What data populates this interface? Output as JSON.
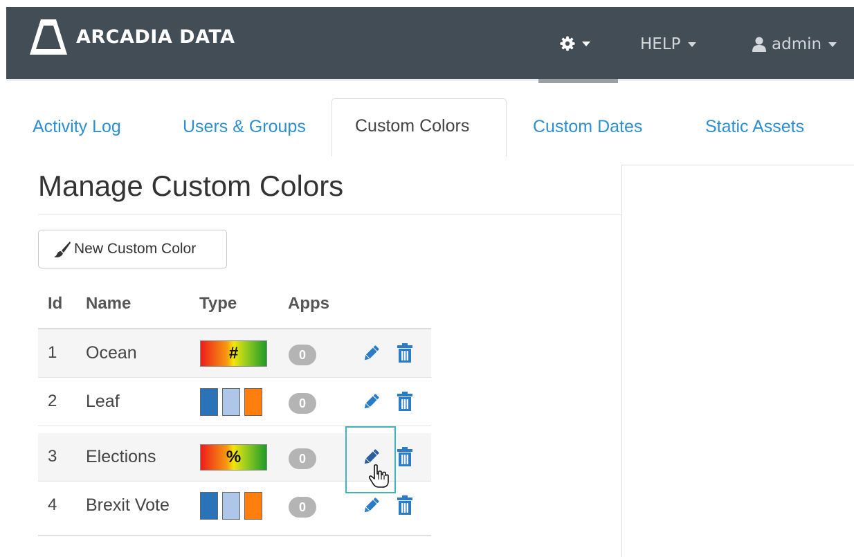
{
  "header": {
    "brand": "ARCADIA DATA",
    "help_label": "HELP",
    "user_label": "admin"
  },
  "tabs": [
    {
      "label": "Activity Log",
      "active": false
    },
    {
      "label": "Users & Groups",
      "active": false
    },
    {
      "label": "Custom Colors",
      "active": true
    },
    {
      "label": "Custom Dates",
      "active": false
    },
    {
      "label": "Static Assets",
      "active": false
    }
  ],
  "page": {
    "title": "Manage Custom Colors",
    "new_button_label": "New Custom Color"
  },
  "table": {
    "columns": [
      "Id",
      "Name",
      "Type",
      "Apps"
    ],
    "rows": [
      {
        "id": "1",
        "name": "Ocean",
        "type": "gradient",
        "gradient_symbol": "#",
        "apps": "0"
      },
      {
        "id": "2",
        "name": "Leaf",
        "type": "distinct",
        "apps": "0"
      },
      {
        "id": "3",
        "name": "Elections",
        "type": "gradient",
        "gradient_symbol": "%",
        "apps": "0"
      },
      {
        "id": "4",
        "name": "Brexit Vote",
        "type": "distinct",
        "apps": "0"
      }
    ]
  },
  "colors": {
    "header_bg": "#434d56",
    "link": "#2d8fd3",
    "icon_blue": "#2b7cc7",
    "icon_blue_active": "#2a5f9e",
    "badge": "#b4b4b4",
    "focus_outline": "#41b3bd",
    "gradient": [
      "#ee1c1c",
      "#f79a10",
      "#f2e60a",
      "#8cc820",
      "#1f9a2a"
    ],
    "distinct_palette": [
      "#2a73b8",
      "#aec7e8",
      "#ff7f0e"
    ]
  },
  "icons": {
    "settings": "gear-icon",
    "user": "user-icon",
    "new": "paintbrush-icon",
    "edit": "pencil-icon",
    "delete": "trash-icon",
    "pointer": "hand-cursor-icon"
  }
}
